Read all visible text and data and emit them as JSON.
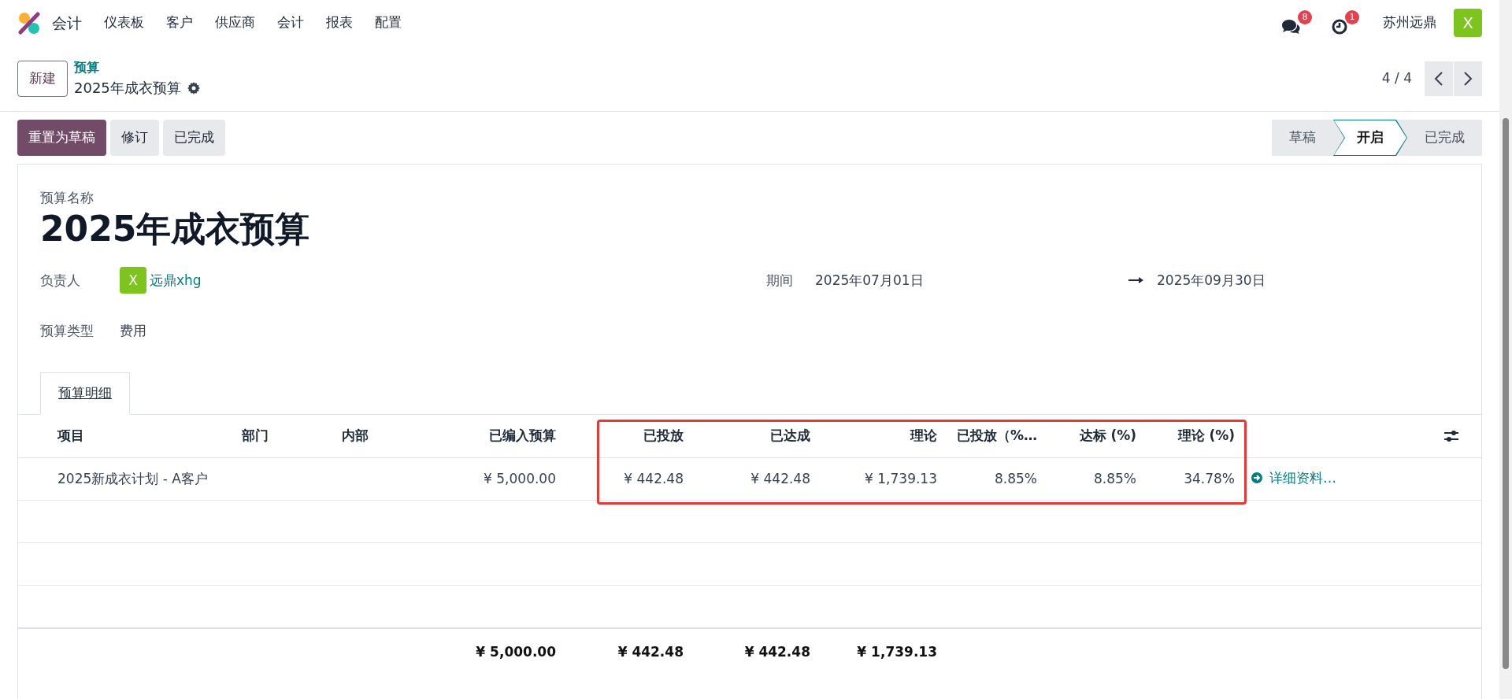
{
  "app": {
    "name": "会计",
    "menu": [
      "仪表板",
      "客户",
      "供应商",
      "会计",
      "报表",
      "配置"
    ]
  },
  "systray": {
    "messages_count": "8",
    "activities_count": "1",
    "company": "苏州远鼎",
    "user_avatar": "X"
  },
  "control_panel": {
    "new_button": "新建",
    "breadcrumb": "预算",
    "record_title": "2025年成衣预算",
    "pager": "4 / 4"
  },
  "actions": [
    {
      "label": "重置为草稿",
      "kind": "primary"
    },
    {
      "label": "修订",
      "kind": "secondary"
    },
    {
      "label": "已完成",
      "kind": "secondary"
    }
  ],
  "stages": [
    {
      "label": "草稿",
      "selected": false
    },
    {
      "label": "开启",
      "selected": true
    },
    {
      "label": "已完成",
      "selected": false
    }
  ],
  "form": {
    "name_label": "预算名称",
    "name": "2025年成衣预算",
    "responsible": {
      "label": "负责人",
      "avatar": "X",
      "name": "远鼎xhg"
    },
    "period": {
      "label": "期间",
      "start": "2025年07月01日",
      "end": "2025年09月30日"
    },
    "budget_type": {
      "label": "预算类型",
      "value": "费用"
    }
  },
  "tabs": [
    {
      "label": "预算明细",
      "selected": true
    }
  ],
  "table": {
    "columns": [
      {
        "label": "项目"
      },
      {
        "label": "部门"
      },
      {
        "label": "内部"
      },
      {
        "label": "已编入预算",
        "total": "¥ 5,000.00"
      },
      {
        "label": "已投放",
        "total": "¥ 442.48"
      },
      {
        "label": "已达成",
        "total": "¥ 442.48"
      },
      {
        "label": "理论",
        "total": "¥ 1,739.13"
      },
      {
        "label": "已投放（%…"
      },
      {
        "label": "达标 (%)"
      },
      {
        "label": "理论 (%)"
      }
    ],
    "rows": [
      {
        "cells": [
          "2025新成衣计划 - A客户",
          "",
          "",
          "¥ 5,000.00",
          "¥ 442.48",
          "¥ 442.48",
          "¥ 1,739.13",
          "8.85%",
          "8.85%",
          "34.78%"
        ],
        "details_link": "详细资料…"
      }
    ]
  }
}
